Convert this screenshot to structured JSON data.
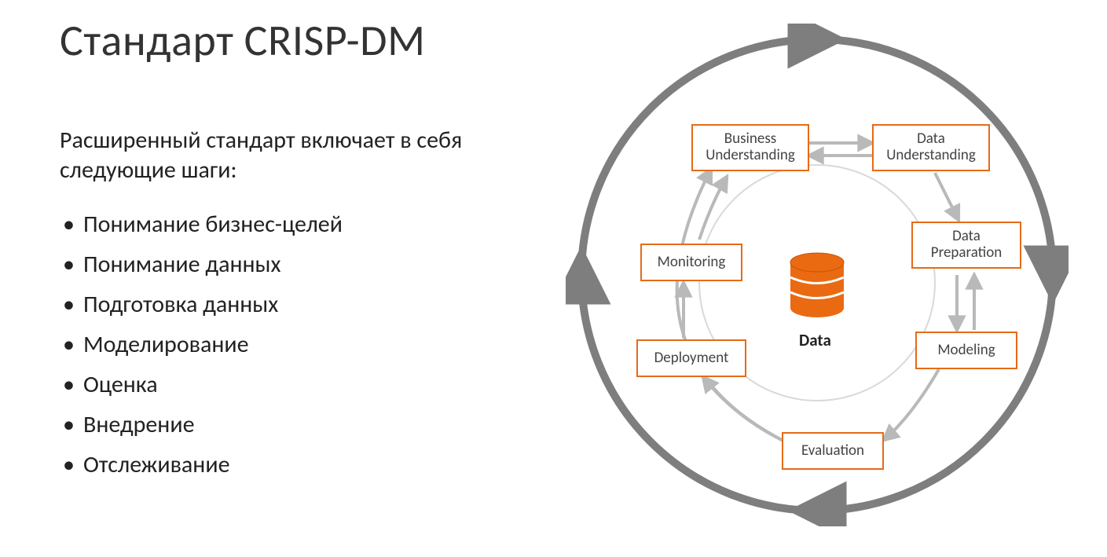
{
  "title": "Стандарт CRISP-DM",
  "lead": "Расширенный стандарт включает в себя следующие шаги:",
  "steps": [
    "Понимание бизнес-целей",
    "Понимание данных",
    "Подготовка данных",
    "Моделирование",
    "Оценка",
    "Внедрение",
    "Отслеживание"
  ],
  "diagram": {
    "center_label": "Data",
    "nodes": {
      "business": "Business\nUnderstanding",
      "data_und": "Data\nUnderstanding",
      "data_prep": "Data\nPreparation",
      "modeling": "Modeling",
      "evaluation": "Evaluation",
      "deployment": "Deployment",
      "monitoring": "Monitoring"
    },
    "colors": {
      "node_border": "#e56b17",
      "ring": "#7e7e7e",
      "arrow": "#b9b9b9",
      "db_fill": "#ea6a12"
    }
  }
}
